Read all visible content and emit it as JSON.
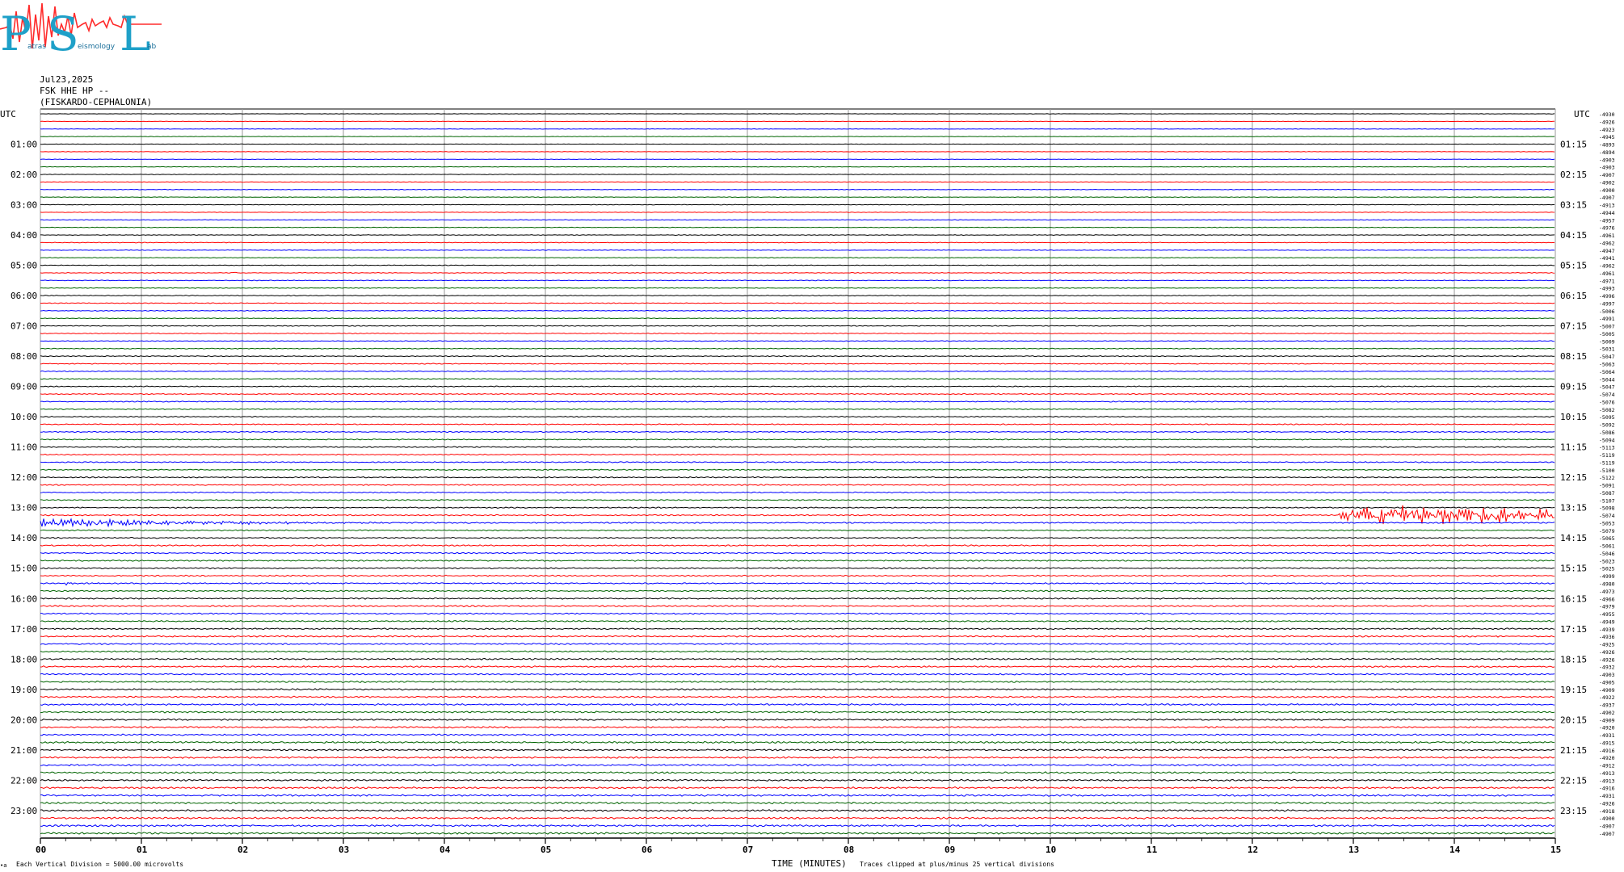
{
  "logo": {
    "big_letters": [
      "P",
      "S",
      "L"
    ],
    "small_words": [
      "atras",
      "eismology",
      "ab"
    ]
  },
  "header": {
    "date": "Jul23,2025",
    "station": "FSK HHE HP --",
    "location": "(FISKARDO-CEPHALONIA)"
  },
  "footer": {
    "scale_note": "Each Vertical Division = 5000.00 microvolts",
    "xlabel": "TIME (MINUTES)",
    "clip_note": "Traces clipped at plus/minus 25 vertical divisions",
    "corner_mark": "•a"
  },
  "colors": {
    "trace_cycle": [
      "#000000",
      "#ff0000",
      "#0000ff",
      "#006400"
    ],
    "grid": "#9a9a9a"
  },
  "chart_data": {
    "type": "line",
    "title": "",
    "xlabel": "TIME (MINUTES)",
    "xlim": [
      0,
      15
    ],
    "x_ticks": [
      "00",
      "01",
      "02",
      "03",
      "04",
      "05",
      "06",
      "07",
      "08",
      "09",
      "10",
      "11",
      "12",
      "13",
      "14",
      "15"
    ],
    "axis_unit_left": "UTC",
    "axis_unit_right": "UTC",
    "left_time_labels": [
      "01:00",
      "02:00",
      "03:00",
      "04:00",
      "05:00",
      "06:00",
      "07:00",
      "08:00",
      "09:00",
      "10:00",
      "11:00",
      "12:00",
      "13:00",
      "14:00",
      "15:00",
      "16:00",
      "17:00",
      "18:00",
      "19:00",
      "20:00",
      "21:00",
      "22:00",
      "23:00"
    ],
    "right_time_labels": [
      "01:15",
      "02:15",
      "03:15",
      "04:15",
      "05:15",
      "06:15",
      "07:15",
      "08:15",
      "09:15",
      "10:15",
      "11:15",
      "12:15",
      "13:15",
      "14:15",
      "15:15",
      "16:15",
      "17:15",
      "18:15",
      "19:15",
      "20:15",
      "21:15",
      "22:15",
      "23:15"
    ],
    "traces_per_hour": 4,
    "trace_count": 96,
    "trace_offsets": [
      "-4930",
      "-4926",
      "-4923",
      "-4945",
      "-4893",
      "-4894",
      "-4903",
      "-4903",
      "-4907",
      "-4902",
      "-4900",
      "-4907",
      "-4913",
      "-4944",
      "-4957",
      "-4976",
      "-4961",
      "-4962",
      "-4947",
      "-4941",
      "-4962",
      "-4961",
      "-4971",
      "-4993",
      "-4996",
      "-4997",
      "-5006",
      "-4991",
      "-5007",
      "-5005",
      "-5009",
      "-5031",
      "-5047",
      "-5063",
      "-5064",
      "-5044",
      "-5047",
      "-5074",
      "-5076",
      "-5082",
      "-5095",
      "-5092",
      "-5086",
      "-5094",
      "-5113",
      "-5119",
      "-5119",
      "-5100",
      "-5122",
      "-5091",
      "-5087",
      "-5107",
      "-5098",
      "-5074",
      "-5053",
      "-5079",
      "-5065",
      "-5061",
      "-5046",
      "-5023",
      "-5025",
      "-4999",
      "-4980",
      "-4973",
      "-4966",
      "-4979",
      "-4955",
      "-4949",
      "-4939",
      "-4936",
      "-4925",
      "-4926",
      "-4926",
      "-4932",
      "-4903",
      "-4905",
      "-4909",
      "-4922",
      "-4937",
      "-4902",
      "-4909",
      "-4920",
      "-4931",
      "-4915",
      "-4916",
      "-4920",
      "-4912",
      "-4913",
      "-4913",
      "-4916",
      "-4931",
      "-4926",
      "-4918",
      "-4900",
      "-4907",
      "-4907"
    ],
    "amplitude_units": "vertical divisions (1 division = 5000.00 microvolts)",
    "clip_divisions": 25,
    "events": [
      {
        "trace_index": 21,
        "start_min": 1.88,
        "duration_min": 0.08,
        "peak_div": 0.6,
        "kind": "local"
      },
      {
        "trace_index": 54,
        "start_min": 0.0,
        "duration_min": 4.5,
        "peak_div": 1.3,
        "kind": "decay"
      },
      {
        "trace_index": 62,
        "start_min": 0.2,
        "duration_min": 0.15,
        "peak_div": 0.35,
        "kind": "local"
      },
      {
        "trace_index": 53,
        "start_min": 12.85,
        "duration_min": 2.15,
        "peak_div": 2.4,
        "kind": "teleseism"
      }
    ]
  }
}
